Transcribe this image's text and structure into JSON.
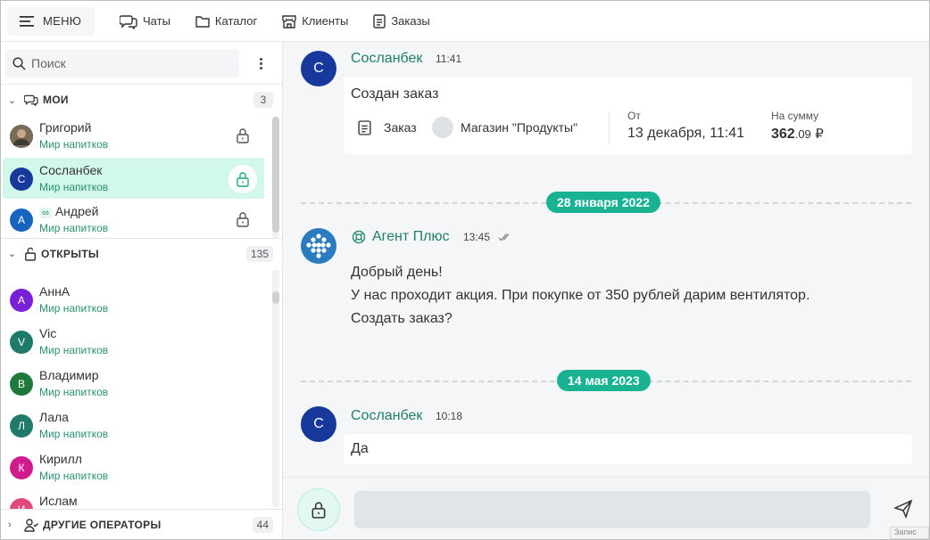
{
  "nav": {
    "menu_label": "МЕНЮ",
    "items": [
      {
        "label": "Чаты",
        "icon": "chats-icon"
      },
      {
        "label": "Каталог",
        "icon": "folder-icon"
      },
      {
        "label": "Клиенты",
        "icon": "store-icon"
      },
      {
        "label": "Заказы",
        "icon": "document-icon"
      }
    ]
  },
  "sidebar": {
    "search_placeholder": "Поиск",
    "mine": {
      "title": "МОИ",
      "count": "3",
      "contacts": [
        {
          "name": "Григорий",
          "sub": "Мир напитков",
          "avatar": "",
          "color": "#6b5a4a"
        },
        {
          "name": "Сосланбек",
          "sub": "Мир напитков",
          "avatar": "С",
          "color": "#17399b"
        },
        {
          "name": "Андрей",
          "sub": "Мир напитков",
          "avatar": "А",
          "color": "#1565c0"
        }
      ]
    },
    "open": {
      "title": "ОТКРЫТЫ",
      "count": "135",
      "contacts": [
        {
          "name": "АннА",
          "sub": "Мир напитков",
          "avatar": "А",
          "color": "#7b1fd6"
        },
        {
          "name": "Vic",
          "sub": "Мир напитков",
          "avatar": "V",
          "color": "#1f7a6b"
        },
        {
          "name": "Владимир",
          "sub": "Мир напитков",
          "avatar": "В",
          "color": "#1e7a3c"
        },
        {
          "name": "Лала",
          "sub": "Мир напитков",
          "avatar": "Л",
          "color": "#1f7a6b"
        },
        {
          "name": "Кирилл",
          "sub": "Мир напитков",
          "avatar": "К",
          "color": "#cf1b8e"
        },
        {
          "name": "Ислам",
          "sub": "",
          "avatar": "И",
          "color": "#e0497a"
        }
      ]
    },
    "others": {
      "title": "ДРУГИЕ ОПЕРАТОРЫ",
      "count": "44"
    }
  },
  "chat": {
    "msg1": {
      "sender": "Сосланбек",
      "avatar": "С",
      "time": "11:41",
      "text": "Создан заказ",
      "order": {
        "label": "Заказ",
        "store": "Магазин \"Продукты\"",
        "from_label": "От",
        "from_value": "13 декабря, 11:41",
        "sum_label": "На сумму",
        "sum_int": "362",
        "sum_frac": ".09",
        "currency": "₽"
      }
    },
    "date1": "28 января 2022",
    "msg2": {
      "sender": "Агент Плюс",
      "time": "13:45",
      "lines": [
        "Добрый день!",
        "У нас проходит акция. При покупке от 350 рублей дарим вентилятор.",
        "Создать заказ?"
      ]
    },
    "date2": "14 мая 2023",
    "msg3": {
      "sender": "Сосланбек",
      "avatar": "С",
      "time": "10:18",
      "text": "Да"
    }
  },
  "composer": {
    "placeholder": ""
  },
  "tooltip": "Запис"
}
